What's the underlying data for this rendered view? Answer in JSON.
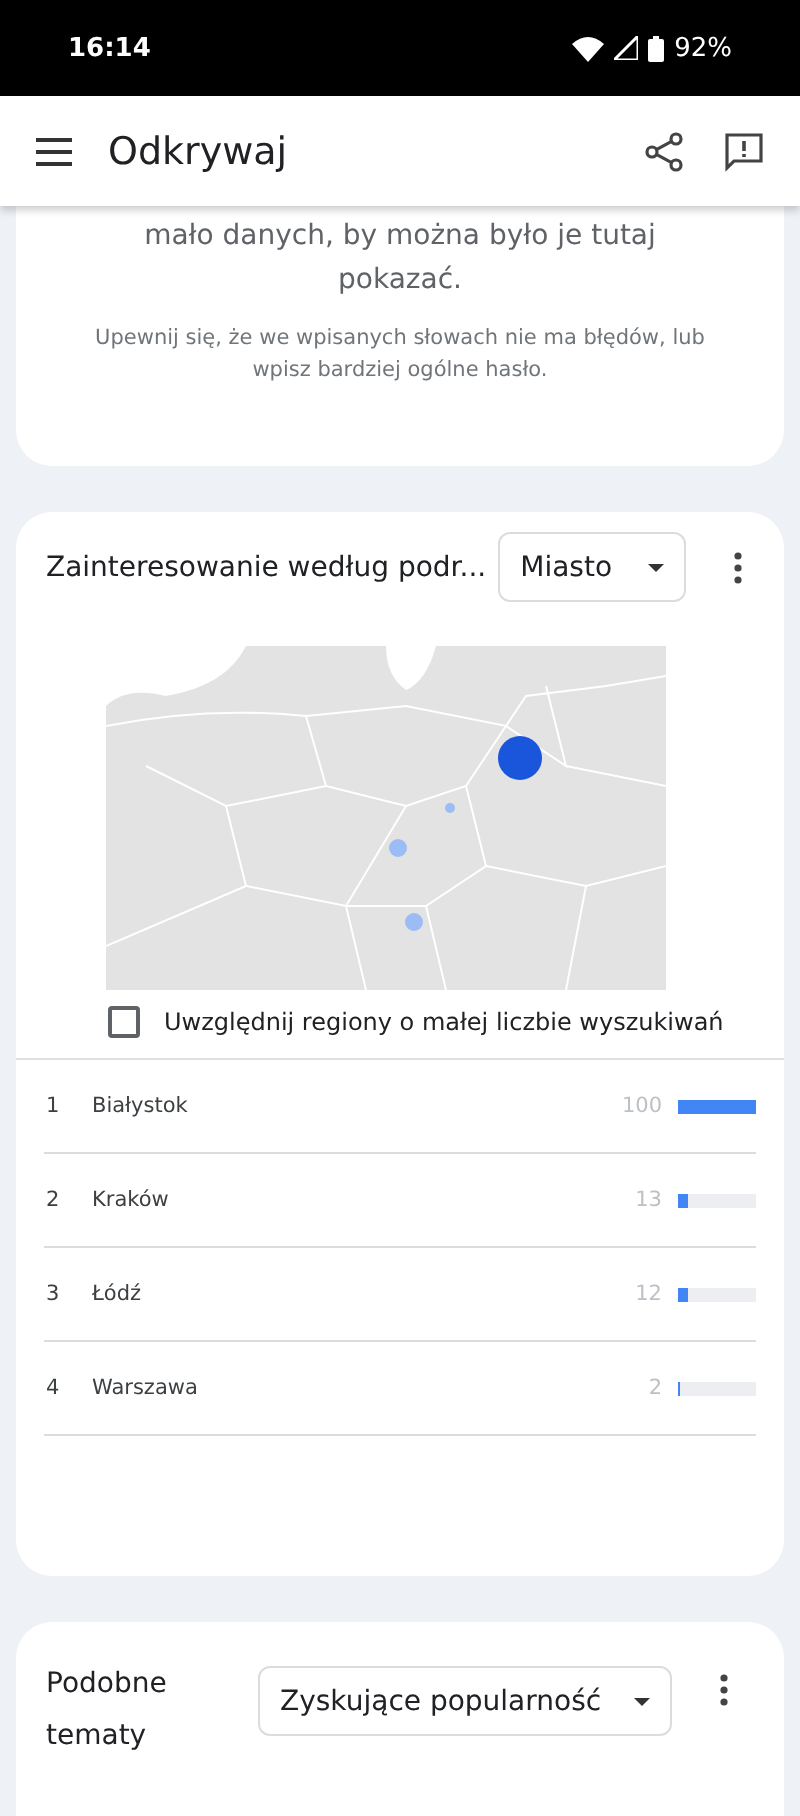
{
  "status_bar": {
    "time": "16:14",
    "battery": "92%"
  },
  "app_bar": {
    "title": "Odkrywaj"
  },
  "notice": {
    "message": "mało danych, by można było je tutaj pokazać.",
    "hint": "Upewnij się, że we wpisanych słowach nie ma błędów, lub wpisz bardziej ogólne hasło."
  },
  "region_card": {
    "title": "Zainteresowanie według podr...",
    "dropdown": "Miasto",
    "low_volume_checkbox": {
      "label": "Uwzględnij regiony o małej liczbie wyszukiwań",
      "checked": false
    },
    "rows": [
      {
        "rank": "1",
        "name": "Białystok",
        "value": "100",
        "level": 1.0
      },
      {
        "rank": "2",
        "name": "Kraków",
        "value": "13",
        "level": 0.13
      },
      {
        "rank": "3",
        "name": "Łódź",
        "value": "12",
        "level": 0.12
      },
      {
        "rank": "4",
        "name": "Warszawa",
        "value": "2",
        "level": 0.02
      }
    ]
  },
  "related_card": {
    "title": "Podobne tematy",
    "dropdown": "Zyskujące popularność"
  }
}
